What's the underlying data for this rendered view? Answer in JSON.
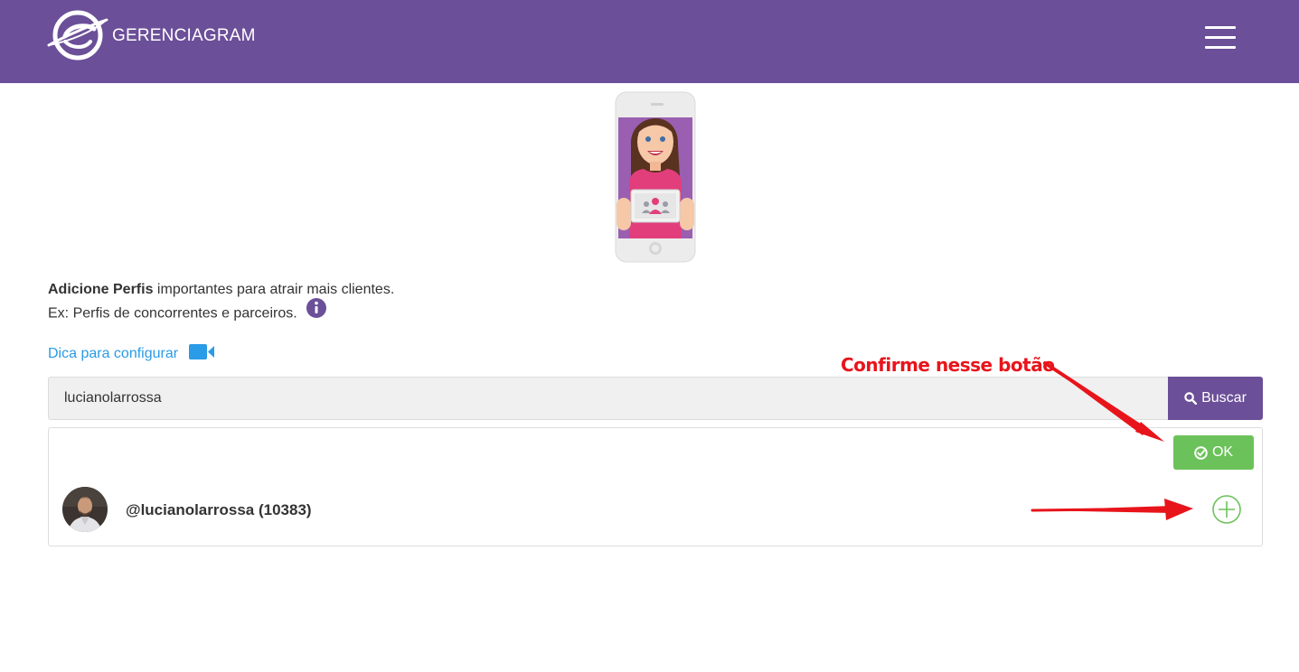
{
  "header": {
    "brand": "GERENCIAGRAM",
    "menu_icon": "hamburger-menu-icon",
    "background": "#6b4f98"
  },
  "intro": {
    "line1_bold": "Adicione Perfis",
    "line1_rest": " importantes para atrair mais clientes.",
    "line2": "Ex: Perfis de concorrentes e parceiros.",
    "info_icon": "info-icon"
  },
  "tip": {
    "label": "Dica para configurar",
    "icon": "video-camera-icon",
    "color": "#2a9be6"
  },
  "search": {
    "value": "lucianolarrossa",
    "button_label": "Buscar",
    "button_icon": "search-icon"
  },
  "results": {
    "ok_label": "OK",
    "ok_icon": "check-circle-icon",
    "ok_color": "#6cc25a",
    "items": [
      {
        "name": "@lucianolarrossa (10383)",
        "action_icon": "plus-circle-icon"
      }
    ]
  },
  "annotation": {
    "label": "Confirme nesse botão",
    "color": "#e8141b"
  }
}
